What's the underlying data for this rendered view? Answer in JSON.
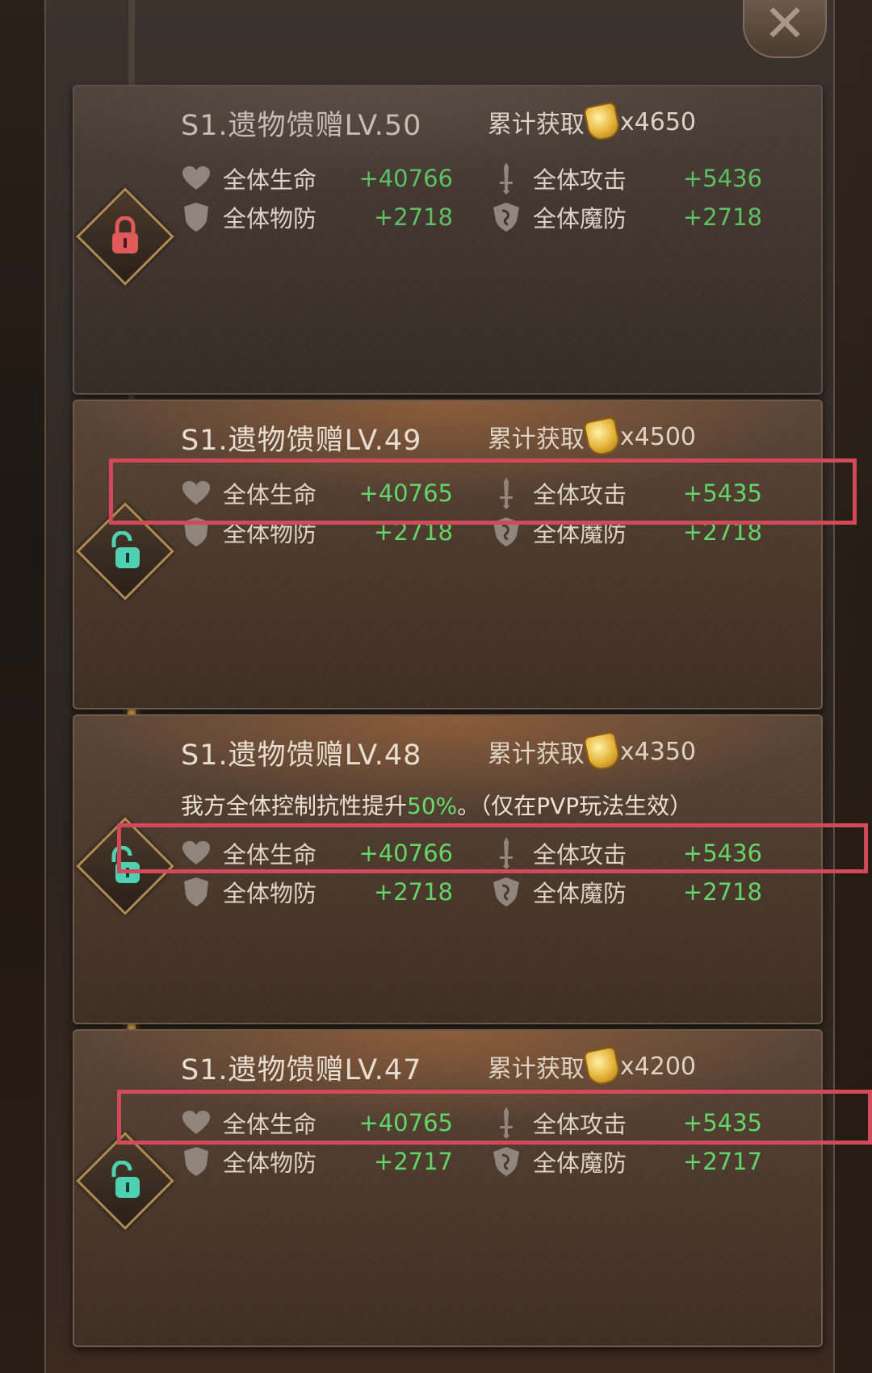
{
  "close_symbol": "✕",
  "cards": [
    {
      "title": "S1.遗物馈赠LV.50",
      "reward_label": "累计获取",
      "reward_amount": "x4650",
      "locked": true,
      "stats": [
        {
          "name": "全体生命",
          "value": "+40766",
          "icon": "heart-icon"
        },
        {
          "name": "全体攻击",
          "value": "+5436",
          "icon": "sword-icon"
        },
        {
          "name": "全体物防",
          "value": "+2718",
          "icon": "shield-icon"
        },
        {
          "name": "全体魔防",
          "value": "+2718",
          "icon": "magic-shield-icon"
        }
      ]
    },
    {
      "title": "S1.遗物馈赠LV.49",
      "reward_label": "累计获取",
      "reward_amount": "x4500",
      "locked": false,
      "stats": [
        {
          "name": "全体生命",
          "value": "+40765",
          "icon": "heart-icon"
        },
        {
          "name": "全体攻击",
          "value": "+5435",
          "icon": "sword-icon"
        },
        {
          "name": "全体物防",
          "value": "+2718",
          "icon": "shield-icon"
        },
        {
          "name": "全体魔防",
          "value": "+2718",
          "icon": "magic-shield-icon"
        }
      ]
    },
    {
      "title": "S1.遗物馈赠LV.48",
      "reward_label": "累计获取",
      "reward_amount": "x4350",
      "locked": false,
      "desc_prefix": "我方全体控制抗性提升",
      "desc_highlight": "50%",
      "desc_suffix": "。（仅在PVP玩法生效）",
      "stats": [
        {
          "name": "全体生命",
          "value": "+40766",
          "icon": "heart-icon"
        },
        {
          "name": "全体攻击",
          "value": "+5436",
          "icon": "sword-icon"
        },
        {
          "name": "全体物防",
          "value": "+2718",
          "icon": "shield-icon"
        },
        {
          "name": "全体魔防",
          "value": "+2718",
          "icon": "magic-shield-icon"
        }
      ]
    },
    {
      "title": "S1.遗物馈赠LV.47",
      "reward_label": "累计获取",
      "reward_amount": "x4200",
      "locked": false,
      "stats": [
        {
          "name": "全体生命",
          "value": "+40765",
          "icon": "heart-icon"
        },
        {
          "name": "全体攻击",
          "value": "+5435",
          "icon": "sword-icon"
        },
        {
          "name": "全体物防",
          "value": "+2717",
          "icon": "shield-icon"
        },
        {
          "name": "全体魔防",
          "value": "+2717",
          "icon": "magic-shield-icon"
        }
      ]
    }
  ],
  "colors": {
    "stat_value": "#63d66a",
    "highlight_box": "#d24a5a",
    "gold_track": "#ffd36a",
    "lock_red": "#e05a5a",
    "unlock_teal": "#4fd0b0"
  }
}
